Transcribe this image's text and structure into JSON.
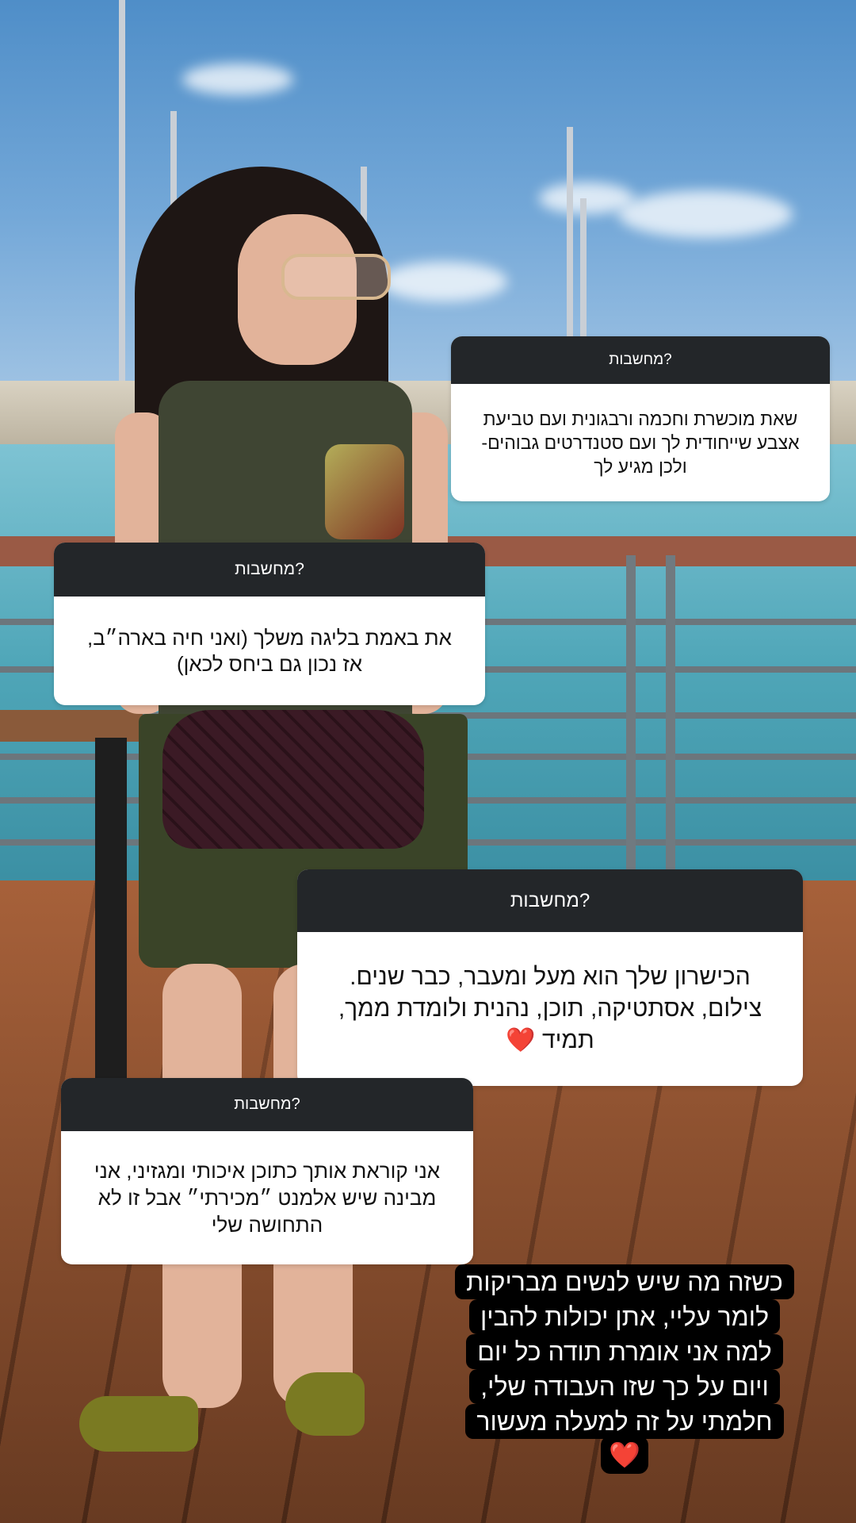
{
  "question_label": "מחשבות?",
  "cards": [
    {
      "header": "מחשבות?",
      "lines": [
        "שאת מוכשרת וחכמה ורבגונית ועם טביעת",
        "אצבע שייחודית לך ועם סטנדרטים גבוהים-",
        "ולכן מגיע לך"
      ]
    },
    {
      "header": "מחשבות?",
      "lines": [
        "את באמת בליגה משלך (ואני חיה בארה״ב,",
        "אז נכון גם ביחס לכאן)"
      ]
    },
    {
      "header": "מחשבות?",
      "lines": [
        "הכישרון שלך הוא מעל ומעבר, כבר שנים.",
        "צילום, אסתטיקה, תוכן, נהנית ולומדת ממך,",
        "תמיד ❤️"
      ]
    },
    {
      "header": "מחשבות?",
      "lines": [
        "אני קוראת אותך כתוכן איכותי ומגזיני, אני",
        "מבינה שיש אלמנט ״מכירתי״ אבל זו לא",
        "התחושה שלי"
      ]
    }
  ],
  "caption": {
    "lines": [
      "כשזה מה שיש לנשים מבריקות",
      "לומר עליי, אתן יכולות להבין",
      "למה אני אומרת תודה כל יום",
      "ויום על כך שזו העבודה שלי,",
      "חלמתי על זה למעלה מעשור"
    ],
    "emoji": "❤️"
  },
  "colors": {
    "card_header_bg": "#232629",
    "card_body_bg": "#ffffff",
    "caption_bg": "#000000"
  }
}
